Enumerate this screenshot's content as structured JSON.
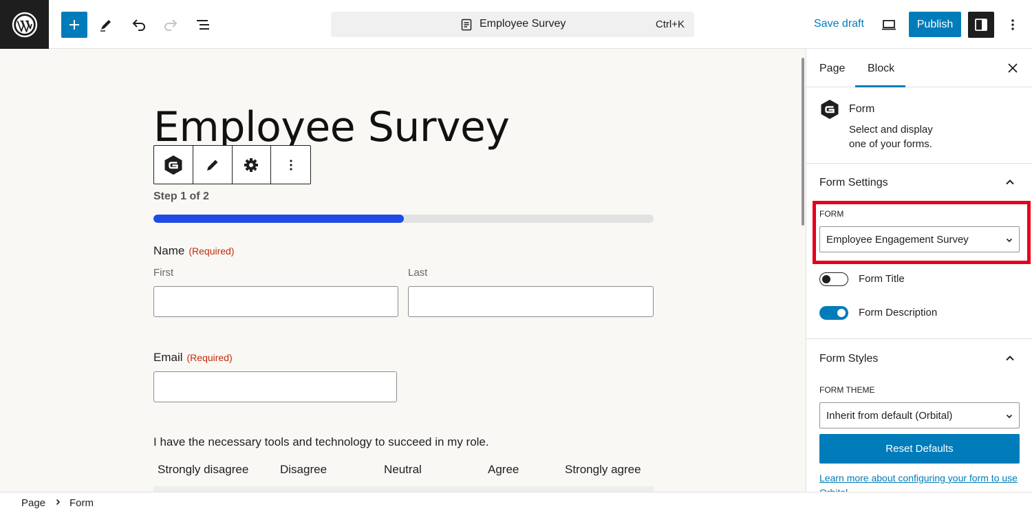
{
  "topbar": {
    "document_title": "Employee Survey",
    "shortcut": "Ctrl+K",
    "save_draft_label": "Save draft",
    "publish_label": "Publish"
  },
  "colors": {
    "accent": "#007cba",
    "progress": "#204ce5",
    "required": "#c02b0a",
    "highlight": "#e5001b"
  },
  "editor": {
    "page_title": "Employee Survey",
    "step_label": "Step 1 of 2",
    "progress_fraction": 0.5,
    "name_field": {
      "label": "Name",
      "required": "(Required)",
      "first_label": "First",
      "last_label": "Last"
    },
    "email_field": {
      "label": "Email",
      "required": "(Required)"
    },
    "question": "I have the necessary tools and technology to succeed in my role.",
    "likert_options": [
      "Strongly disagree",
      "Disagree",
      "Neutral",
      "Agree",
      "Strongly agree"
    ]
  },
  "sidebar": {
    "tabs": [
      {
        "label": "Page"
      },
      {
        "label": "Block"
      }
    ],
    "active_tab": "Block",
    "block": {
      "name": "Form",
      "description": "Select and display one of your forms."
    },
    "form_settings": {
      "title": "Form Settings",
      "form_label": "FORM",
      "form_value": "Employee Engagement Survey",
      "toggles": [
        {
          "label": "Form Title",
          "on": false
        },
        {
          "label": "Form Description",
          "on": true
        }
      ]
    },
    "form_styles": {
      "title": "Form Styles",
      "theme_label": "FORM THEME",
      "theme_value": "Inherit from default (Orbital)",
      "reset_label": "Reset Defaults",
      "learn_more": "Learn more about configuring your form to use Orbital"
    }
  },
  "breadcrumb": {
    "items": [
      "Page",
      "Form"
    ]
  }
}
